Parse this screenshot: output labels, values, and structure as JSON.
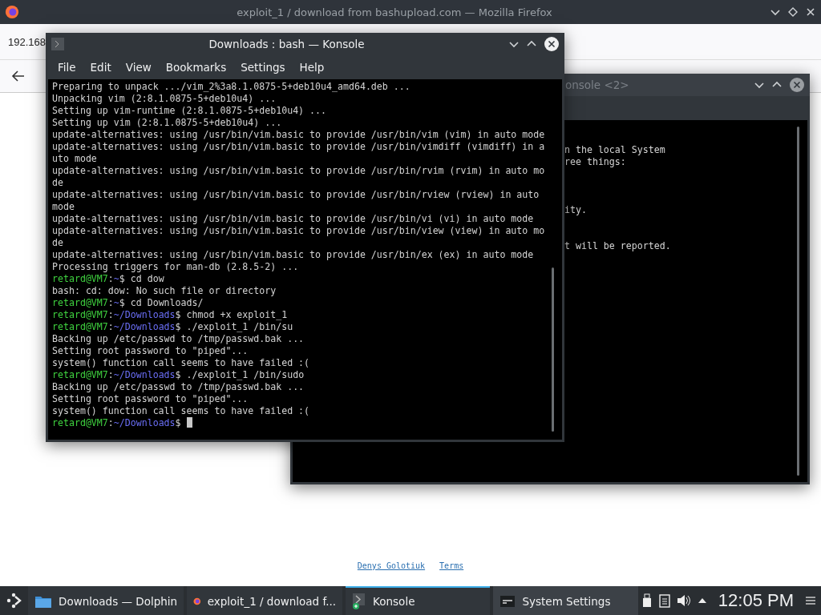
{
  "browser": {
    "title": "exploit_1 / download from bashupload.com — Mozilla Firefox",
    "address_fragment": "192.168",
    "footer_links": [
      "Denys Golotiuk",
      "Terms"
    ]
  },
  "back_window": {
    "title": "onsole <2>",
    "lines": [
      {
        "kind": "text",
        "text": "n the local System"
      },
      {
        "kind": "text",
        "text": "ree things:"
      },
      {
        "kind": "blank"
      },
      {
        "kind": "blank"
      },
      {
        "kind": "blank"
      },
      {
        "kind": "text",
        "text": "ity."
      },
      {
        "kind": "blank"
      },
      {
        "kind": "blank"
      },
      {
        "kind": "text",
        "text": "t will be reported."
      }
    ]
  },
  "konsole": {
    "title": "Downloads : bash — Konsole",
    "menu": [
      "File",
      "Edit",
      "View",
      "Bookmarks",
      "Settings",
      "Help"
    ],
    "lines": [
      {
        "kind": "output",
        "text": "Preparing to unpack .../vim_2%3a8.1.0875-5+deb10u4_amd64.deb ..."
      },
      {
        "kind": "output",
        "text": "Unpacking vim (2:8.1.0875-5+deb10u4) ..."
      },
      {
        "kind": "output",
        "text": "Setting up vim-runtime (2:8.1.0875-5+deb10u4) ..."
      },
      {
        "kind": "output",
        "text": "Setting up vim (2:8.1.0875-5+deb10u4) ..."
      },
      {
        "kind": "output",
        "text": "update-alternatives: using /usr/bin/vim.basic to provide /usr/bin/vim (vim) in auto mode"
      },
      {
        "kind": "output",
        "text": "update-alternatives: using /usr/bin/vim.basic to provide /usr/bin/vimdiff (vimdiff) in a"
      },
      {
        "kind": "output",
        "text": "uto mode"
      },
      {
        "kind": "output",
        "text": "update-alternatives: using /usr/bin/vim.basic to provide /usr/bin/rvim (rvim) in auto mo"
      },
      {
        "kind": "output",
        "text": "de"
      },
      {
        "kind": "output",
        "text": "update-alternatives: using /usr/bin/vim.basic to provide /usr/bin/rview (rview) in auto"
      },
      {
        "kind": "output",
        "text": "mode"
      },
      {
        "kind": "output",
        "text": "update-alternatives: using /usr/bin/vim.basic to provide /usr/bin/vi (vi) in auto mode"
      },
      {
        "kind": "output",
        "text": "update-alternatives: using /usr/bin/vim.basic to provide /usr/bin/view (view) in auto mo"
      },
      {
        "kind": "output",
        "text": "de"
      },
      {
        "kind": "output",
        "text": "update-alternatives: using /usr/bin/vim.basic to provide /usr/bin/ex (ex) in auto mode"
      },
      {
        "kind": "output",
        "text": "Processing triggers for man-db (2.8.5-2) ..."
      },
      {
        "kind": "prompt",
        "user": "retard@VM7",
        "separator": ":",
        "path": "~",
        "command": "$ cd dow"
      },
      {
        "kind": "output",
        "text": "bash: cd: dow: No such file or directory"
      },
      {
        "kind": "prompt",
        "user": "retard@VM7",
        "separator": ":",
        "path": "~",
        "command": "$ cd Downloads/"
      },
      {
        "kind": "prompt",
        "user": "retard@VM7",
        "separator": ":",
        "path": "~/Downloads",
        "command": "$ chmod +x exploit_1"
      },
      {
        "kind": "prompt",
        "user": "retard@VM7",
        "separator": ":",
        "path": "~/Downloads",
        "command": "$ ./exploit_1 /bin/su"
      },
      {
        "kind": "output",
        "text": "Backing up /etc/passwd to /tmp/passwd.bak ..."
      },
      {
        "kind": "output",
        "text": "Setting root password to \"piped\"..."
      },
      {
        "kind": "output",
        "text": "system() function call seems to have failed :("
      },
      {
        "kind": "prompt",
        "user": "retard@VM7",
        "separator": ":",
        "path": "~/Downloads",
        "command": "$ ./exploit_1 /bin/sudo"
      },
      {
        "kind": "output",
        "text": "Backing up /etc/passwd to /tmp/passwd.bak ..."
      },
      {
        "kind": "output",
        "text": "Setting root password to \"piped\"..."
      },
      {
        "kind": "output",
        "text": "system() function call seems to have failed :("
      },
      {
        "kind": "prompt",
        "user": "retard@VM7",
        "separator": ":",
        "path": "~/Downloads",
        "command": "$",
        "cursor": true
      }
    ]
  },
  "taskbar": {
    "tasks": [
      {
        "kind": "folder",
        "label": "Downloads — Dolphin",
        "selected": false
      },
      {
        "kind": "firefox",
        "label": "exploit_1 / download f...",
        "selected": false
      },
      {
        "kind": "terminal",
        "label": "Konsole",
        "selected": true
      },
      {
        "kind": "settings",
        "label": "System Settings",
        "selected": false
      }
    ],
    "clock": "12:05 PM"
  }
}
